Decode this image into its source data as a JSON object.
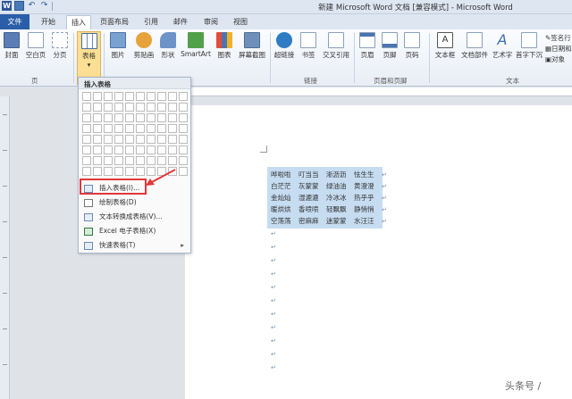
{
  "window": {
    "title": "新建 Microsoft Word 文档 [兼容模式] - Microsoft Word"
  },
  "qat": {
    "app_logo": "W"
  },
  "tabs": [
    {
      "label": "文件"
    },
    {
      "label": "开始"
    },
    {
      "label": "插入"
    },
    {
      "label": "页面布局"
    },
    {
      "label": "引用"
    },
    {
      "label": "邮件"
    },
    {
      "label": "审阅"
    },
    {
      "label": "视图"
    }
  ],
  "ribbon": {
    "buttons": [
      {
        "label": "封面",
        "icon": "cover-icon",
        "color": "#5b7db5"
      },
      {
        "label": "空白页",
        "icon": "blank-page-icon",
        "color": "#ffffff"
      },
      {
        "label": "分页",
        "icon": "page-break-icon",
        "color": "#ffffff"
      },
      {
        "label": "表格",
        "icon": "table-icon",
        "color": "#ffffff"
      },
      {
        "label": "图片",
        "icon": "picture-icon",
        "color": "#7aa2d0"
      },
      {
        "label": "剪贴画",
        "icon": "clipart-icon",
        "color": "#e7a33a"
      },
      {
        "label": "形状",
        "icon": "shapes-icon",
        "color": "#6d93c8"
      },
      {
        "label": "SmartArt",
        "icon": "smartart-icon",
        "color": "#51a04a"
      },
      {
        "label": "图表",
        "icon": "chart-icon",
        "color": "#4b74b2"
      },
      {
        "label": "屏幕截图",
        "icon": "screenshot-icon",
        "color": "#6d8fb9"
      },
      {
        "label": "超链接",
        "icon": "hyperlink-icon",
        "color": "#2e7dc4"
      },
      {
        "label": "书签",
        "icon": "bookmark-icon",
        "color": "#ffffff"
      },
      {
        "label": "交叉引用",
        "icon": "cross-reference-icon",
        "color": "#ffffff"
      },
      {
        "label": "页眉",
        "icon": "header-icon",
        "color": "#ffffff"
      },
      {
        "label": "页脚",
        "icon": "footer-icon",
        "color": "#ffffff"
      },
      {
        "label": "页码",
        "icon": "page-number-icon",
        "color": "#ffffff"
      },
      {
        "label": "文本框",
        "icon": "textbox-icon",
        "color": "#ffffff"
      },
      {
        "label": "文档部件",
        "icon": "quick-parts-icon",
        "color": "#ffffff"
      },
      {
        "label": "艺术字",
        "icon": "wordart-icon",
        "color": "#3f6fb0"
      },
      {
        "label": "首字下沉",
        "icon": "drop-cap-icon",
        "color": "#ffffff"
      }
    ],
    "right_items": [
      "签名行",
      "日期和",
      "对象"
    ],
    "groups": [
      "页",
      "链接",
      "页眉和页脚",
      "文本"
    ]
  },
  "dropdown": {
    "header": "插入表格",
    "items": [
      {
        "label": "插入表格(I)...",
        "icon": "insert-table-icon"
      },
      {
        "label": "绘制表格(D)",
        "icon": "draw-table-icon"
      },
      {
        "label": "文本转换成表格(V)...",
        "icon": "convert-text-icon"
      },
      {
        "label": "Excel 电子表格(X)",
        "icon": "excel-icon"
      },
      {
        "label": "快速表格(T)",
        "icon": "quick-table-icon",
        "submenu": true
      }
    ]
  },
  "document": {
    "rows": [
      [
        "哗啦啦",
        "叮当当",
        "淅沥沥",
        "怯生生"
      ],
      [
        "白茫茫",
        "灰蒙蒙",
        "绿油油",
        "黄澄澄"
      ],
      [
        "金灿灿",
        "湿漉漉",
        "冷冰冰",
        "热乎乎"
      ],
      [
        "暖烘烘",
        "香喷喷",
        "轻飘飘",
        "静悄悄"
      ],
      [
        "空荡荡",
        "密麻麻",
        "迷蒙蒙",
        "水汪汪"
      ]
    ],
    "paragraph_mark": "↵",
    "empty_paragraphs": 11
  },
  "watermark": "头条号 /",
  "colors": {
    "file_tab": "#2a5ea8",
    "selection": "#c6dcf1",
    "highlight_box": "#e0383b",
    "active_button": "#fcdf92"
  }
}
